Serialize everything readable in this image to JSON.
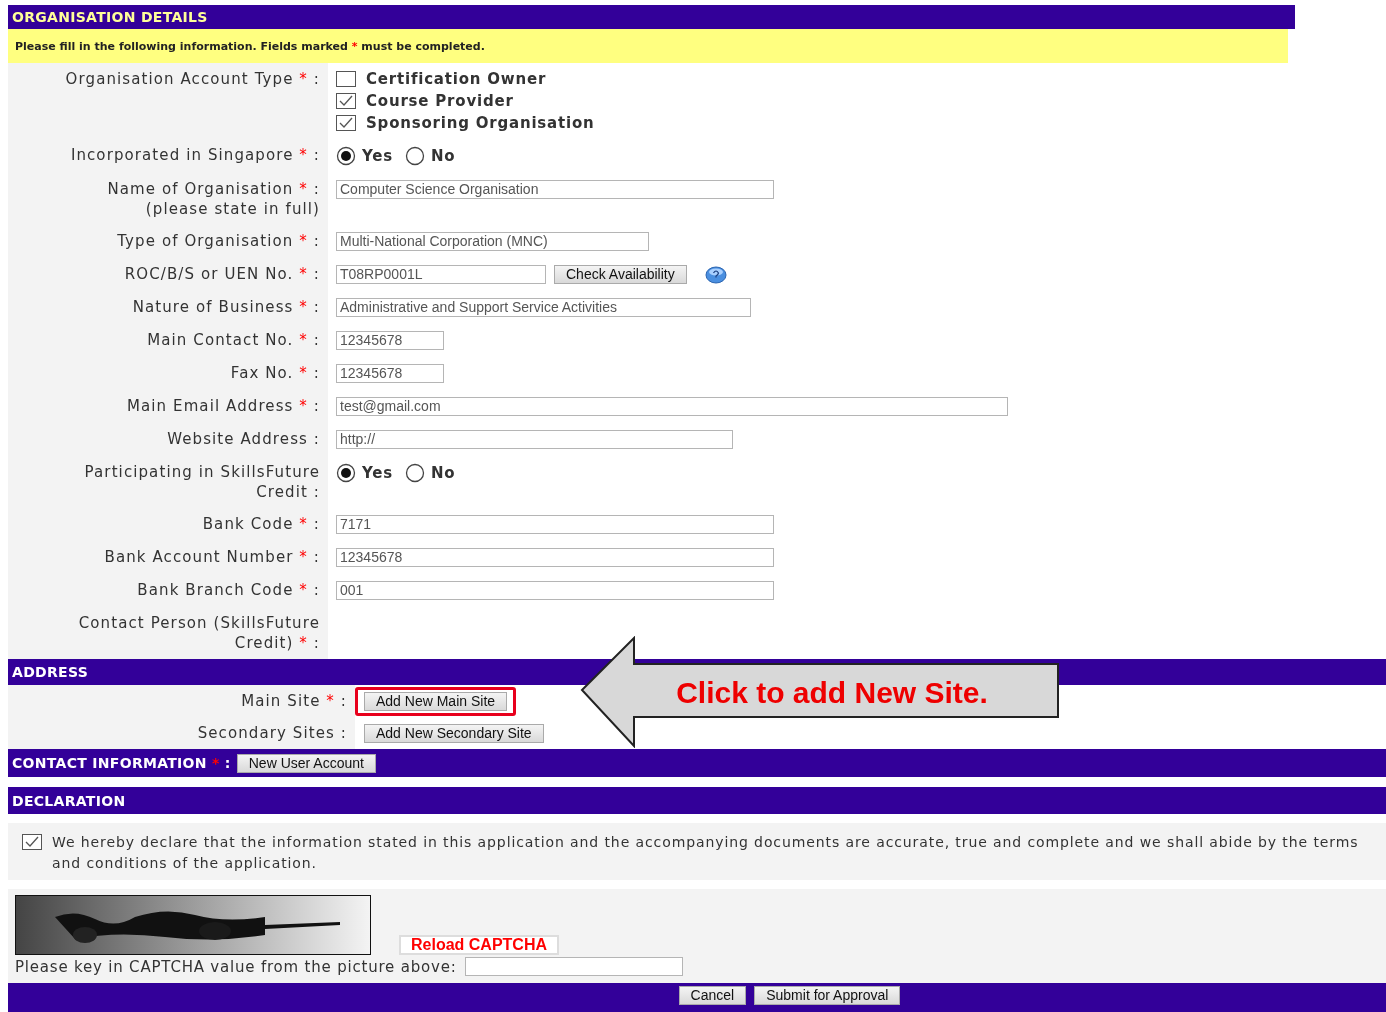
{
  "header": {
    "title": "ORGANISATION DETAILS"
  },
  "notice": {
    "before": "Please fill in the following information. Fields marked",
    "mark": "*",
    "after": "must be completed."
  },
  "fields": [
    {
      "kind": "checks",
      "label": "Organisation Account Type",
      "mark": "*",
      "suffix": ":",
      "options": [
        {
          "label": "Certification Owner",
          "checked": false
        },
        {
          "label": "Course Provider",
          "checked": true
        },
        {
          "label": "Sponsoring Organisation",
          "checked": true
        }
      ]
    },
    {
      "kind": "radio",
      "label": "Incorporated in Singapore",
      "mark": "*",
      "suffix": ":",
      "options": [
        {
          "label": "Yes",
          "selected": true
        },
        {
          "label": "No",
          "selected": false
        }
      ]
    },
    {
      "kind": "text",
      "label": "Name of Organisation",
      "mark": "*",
      "suffix": ":",
      "note": "(please state in full)",
      "value": "Computer Science Organisation"
    },
    {
      "kind": "text",
      "label": "Type of Organisation",
      "mark": "*",
      "suffix": ":",
      "value": "Multi-National Corporation (MNC)"
    },
    {
      "kind": "text_button",
      "label": "ROC/B/S or UEN No.",
      "mark": "*",
      "suffix": ":",
      "value": "T08RP0001L",
      "button": "Check Availability"
    },
    {
      "kind": "text",
      "label": "Nature of Business",
      "mark": "*",
      "suffix": ":",
      "value": "Administrative and Support Service Activities"
    },
    {
      "kind": "text",
      "label": "Main Contact No.",
      "mark": "*",
      "suffix": ":",
      "value": "12345678"
    },
    {
      "kind": "text",
      "label": "Fax No.",
      "mark": "*",
      "suffix": ":",
      "value": "12345678"
    },
    {
      "kind": "text",
      "label": "Main Email Address",
      "mark": "*",
      "suffix": ":",
      "value": "test@gmail.com"
    },
    {
      "kind": "text",
      "label": "Website Address",
      "suffix": ":",
      "value": "http://"
    },
    {
      "kind": "radio",
      "label": "Participating in SkillsFuture Credit",
      "suffix": ":",
      "options": [
        {
          "label": "Yes",
          "selected": true
        },
        {
          "label": "No",
          "selected": false
        }
      ]
    },
    {
      "kind": "text",
      "label": "Bank Code",
      "mark": "*",
      "suffix": ":",
      "value": "7171"
    },
    {
      "kind": "text",
      "label": "Bank Account Number",
      "mark": "*",
      "suffix": ":",
      "value": "12345678"
    },
    {
      "kind": "text",
      "label": "Bank Branch Code",
      "mark": "*",
      "suffix": ":",
      "value": "001"
    },
    {
      "kind": "empty",
      "label": "Contact Person (SkillsFuture Credit)",
      "mark": "*",
      "suffix": ":"
    }
  ],
  "address": {
    "title": "ADDRESS",
    "rows": [
      {
        "label": "Main Site",
        "mark": "*",
        "suffix": ":",
        "button": "Add New Main Site",
        "highlighted": true
      },
      {
        "label": "Secondary Sites",
        "suffix": ":",
        "button": "Add New Secondary Site",
        "highlighted": false
      }
    ]
  },
  "callout": {
    "text": "Click to add New Site."
  },
  "contact": {
    "title": "CONTACT INFORMATION",
    "mark": "*",
    "suffix": ":",
    "button": "New User Account"
  },
  "declaration": {
    "title": "DECLARATION",
    "checked": true,
    "text": "We hereby declare that the information stated in this application and the accompanying documents are accurate, true and complete and we shall abide by the terms and conditions of the application."
  },
  "captcha": {
    "reload": "Reload CAPTCHA",
    "prompt": "Please key in CAPTCHA value from the picture above:"
  },
  "footer": {
    "buttons": [
      "Cancel",
      "Submit for Approval"
    ]
  }
}
